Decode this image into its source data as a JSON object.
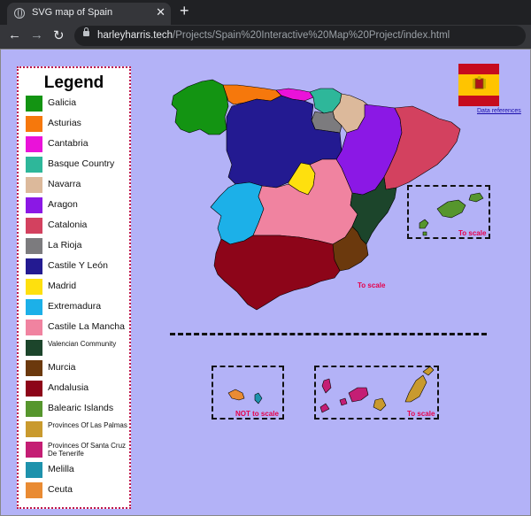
{
  "browser": {
    "tab_title": "SVG map of Spain",
    "tab_close": "✕",
    "new_tab": "+",
    "url_host": "harleyharris.tech",
    "url_path": "/Projects/Spain%20Interactive%20Map%20Project/index.html"
  },
  "legend": {
    "title": "Legend",
    "items": [
      {
        "label": "Galicia",
        "color": "#139412"
      },
      {
        "label": "Asturias",
        "color": "#f6780c"
      },
      {
        "label": "Cantabria",
        "color": "#ea12d9"
      },
      {
        "label": "Basque Country",
        "color": "#2eb79a"
      },
      {
        "label": "Navarra",
        "color": "#dcb99b"
      },
      {
        "label": "Aragon",
        "color": "#8b18e5"
      },
      {
        "label": "Catalonia",
        "color": "#d3415f"
      },
      {
        "label": "La Rioja",
        "color": "#7c7b7e"
      },
      {
        "label": "Castile Y León",
        "color": "#231a91"
      },
      {
        "label": "Madrid",
        "color": "#fee00e"
      },
      {
        "label": "Extremadura",
        "color": "#1cb0e8"
      },
      {
        "label": "Castile La Mancha",
        "color": "#f083a0"
      },
      {
        "label": "Valencian Community",
        "color": "#1c452b"
      },
      {
        "label": "Murcia",
        "color": "#6b390d"
      },
      {
        "label": "Andalusia",
        "color": "#8d0519"
      },
      {
        "label": "Balearic Islands",
        "color": "#56962d"
      },
      {
        "label": "Provinces Of Las Palmas",
        "color": "#c99a2e"
      },
      {
        "label": "Provinces Of Santa Cruz De Tenerife",
        "color": "#c41e74"
      },
      {
        "label": "Melilla",
        "color": "#1e92ac"
      },
      {
        "label": "Ceuta",
        "color": "#e98b33"
      }
    ]
  },
  "flag": {
    "reference_link": "Data references",
    "red": "#c60b1e",
    "yellow": "#ffc400"
  },
  "map": {
    "mainland_note": "To scale",
    "balearic_note": "To scale",
    "ceuta_melilla_note": "NOT to scale",
    "canary_note": "To scale"
  }
}
